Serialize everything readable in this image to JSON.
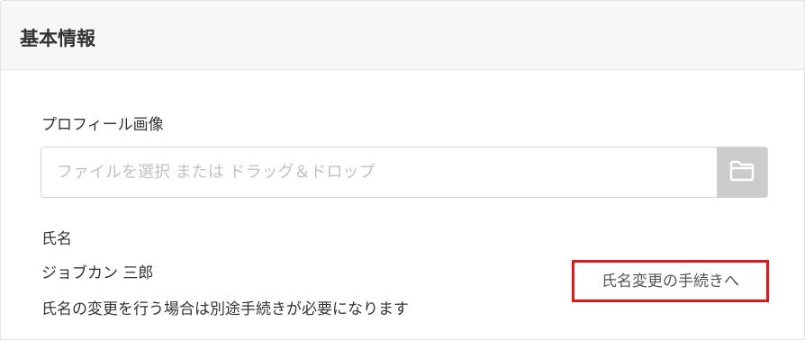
{
  "section": {
    "title": "基本情報"
  },
  "profile_image": {
    "label": "プロフィール画像",
    "placeholder": "ファイルを選択 または ドラッグ＆ドロップ",
    "button_icon": "folder-icon"
  },
  "name": {
    "label": "氏名",
    "value": "ジョブカン 三郎",
    "note": "氏名の変更を行う場合は別途手続きが必要になります",
    "change_link": "氏名変更の手続きへ"
  },
  "colors": {
    "header_bg": "#f7f7f7",
    "border": "#e3e3e3",
    "file_button_bg": "#cccccc",
    "highlight": "#e0191d"
  }
}
